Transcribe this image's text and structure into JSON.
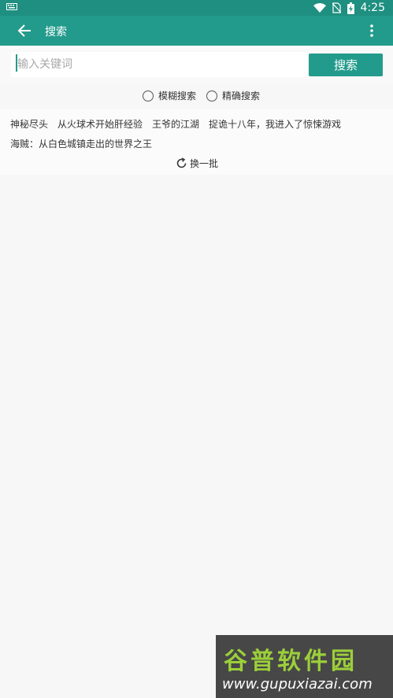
{
  "status_bar": {
    "time": "4:25"
  },
  "app_bar": {
    "title": "搜索"
  },
  "search": {
    "placeholder": "输入关键词",
    "button_label": "搜索"
  },
  "modes": [
    {
      "label": "模糊搜索"
    },
    {
      "label": "精确搜索"
    }
  ],
  "tags": [
    "神秘尽头",
    "从火球术开始肝经验",
    "王爷的江湖",
    "捉诡十八年，我进入了惊悚游戏",
    "海贼：从白色城镇走出的世界之王"
  ],
  "refresh_label": "换一批",
  "watermark": {
    "name": "谷普软件园",
    "url": "www.gupuxiazai.com"
  },
  "colors": {
    "primary": "#239b8c",
    "status_bar": "#1e8f80",
    "background": "#f7f7f7"
  }
}
